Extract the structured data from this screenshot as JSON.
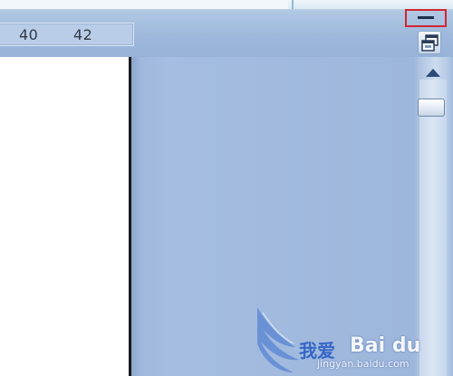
{
  "ruler": {
    "numbers": [
      "40",
      "42"
    ]
  },
  "window_controls": {
    "minimize_icon": "minimize-icon",
    "restore_icon": "restore-window-icon",
    "highlight_color": "#d2262f"
  },
  "scrollbar": {
    "up_icon": "scroll-up-arrow-icon"
  },
  "watermark": {
    "brand_text": "我爱",
    "baidu_text": "Bai du",
    "url": "jingyan.baidu.com"
  },
  "colors": {
    "workspace": "#a0b9dd",
    "toolbar": "#a5bfe0",
    "page": "#ffffff"
  }
}
